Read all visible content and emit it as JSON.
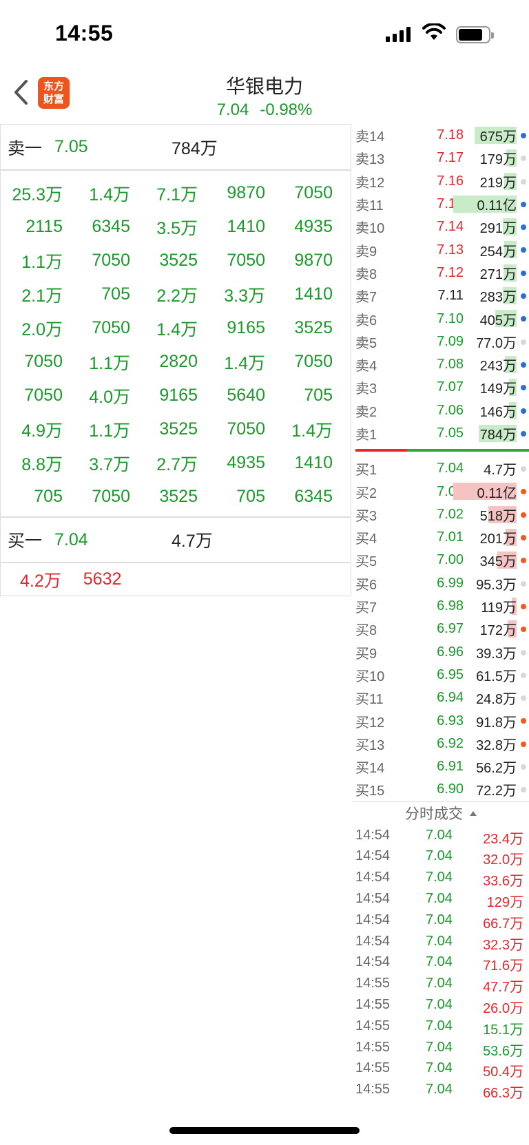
{
  "status_bar": {
    "time": "14:55"
  },
  "header": {
    "logo_text": "东方财富",
    "stock_name": "华银电力",
    "price": "7.04",
    "change_pct": "-0.98%"
  },
  "summary": {
    "sell_label": "卖一",
    "sell_price": "7.05",
    "sell_volume": "784万",
    "buy_label": "买一",
    "buy_price": "7.04",
    "buy_volume": "4.7万"
  },
  "queue_grid": [
    [
      "25.3万",
      "1.4万",
      "7.1万",
      "9870",
      "7050"
    ],
    [
      "2115",
      "6345",
      "3.5万",
      "1410",
      "4935"
    ],
    [
      "1.1万",
      "7050",
      "3525",
      "7050",
      "9870"
    ],
    [
      "2.1万",
      "705",
      "2.2万",
      "3.3万",
      "1410"
    ],
    [
      "2.0万",
      "7050",
      "1.4万",
      "9165",
      "3525"
    ],
    [
      "7050",
      "1.1万",
      "2820",
      "1.4万",
      "7050"
    ],
    [
      "7050",
      "4.0万",
      "9165",
      "5640",
      "705"
    ],
    [
      "4.9万",
      "1.1万",
      "3525",
      "7050",
      "1.4万"
    ],
    [
      "8.8万",
      "3.7万",
      "2.7万",
      "4935",
      "1410"
    ],
    [
      "705",
      "7050",
      "3525",
      "705",
      "6345"
    ]
  ],
  "buy_queue_extra": [
    "4.2万",
    "5632"
  ],
  "order_book": {
    "asks": [
      {
        "label": "卖14",
        "price": "7.18",
        "volume": "675万",
        "price_color": "red",
        "bar": 0.66,
        "dot": "blue"
      },
      {
        "label": "卖13",
        "price": "7.17",
        "volume": "179万",
        "price_color": "red",
        "bar": 0.16,
        "dot": "grey"
      },
      {
        "label": "卖12",
        "price": "7.16",
        "volume": "219万",
        "price_color": "red",
        "bar": 0.2,
        "dot": "grey"
      },
      {
        "label": "卖11",
        "price": "7.15",
        "volume": "0.11亿",
        "price_color": "red",
        "bar": 1.0,
        "dot": "blue"
      },
      {
        "label": "卖10",
        "price": "7.14",
        "volume": "291万",
        "price_color": "red",
        "bar": 0.22,
        "dot": "blue"
      },
      {
        "label": "卖9",
        "price": "7.13",
        "volume": "254万",
        "price_color": "red",
        "bar": 0.2,
        "dot": "blue"
      },
      {
        "label": "卖8",
        "price": "7.12",
        "volume": "271万",
        "price_color": "red",
        "bar": 0.21,
        "dot": "blue"
      },
      {
        "label": "卖7",
        "price": "7.11",
        "volume": "283万",
        "price_color": "black",
        "bar": 0.22,
        "dot": "blue"
      },
      {
        "label": "卖6",
        "price": "7.10",
        "volume": "405万",
        "price_color": "green",
        "bar": 0.34,
        "dot": "blue"
      },
      {
        "label": "卖5",
        "price": "7.09",
        "volume": "77.0万",
        "price_color": "green",
        "bar": 0.0,
        "dot": "grey"
      },
      {
        "label": "卖4",
        "price": "7.08",
        "volume": "243万",
        "price_color": "green",
        "bar": 0.18,
        "dot": "blue"
      },
      {
        "label": "卖3",
        "price": "7.07",
        "volume": "149万",
        "price_color": "green",
        "bar": 0.12,
        "dot": "blue"
      },
      {
        "label": "卖2",
        "price": "7.06",
        "volume": "146万",
        "price_color": "green",
        "bar": 0.12,
        "dot": "blue"
      },
      {
        "label": "卖1",
        "price": "7.05",
        "volume": "784万",
        "price_color": "green",
        "bar": 0.6,
        "dot": "blue"
      }
    ],
    "bids": [
      {
        "label": "买1",
        "price": "7.04",
        "volume": "4.7万",
        "price_color": "green",
        "bar": 0.0,
        "dot": "grey"
      },
      {
        "label": "买2",
        "price": "7.03",
        "volume": "0.11亿",
        "price_color": "green",
        "bar": 1.0,
        "dot": "orange"
      },
      {
        "label": "买3",
        "price": "7.02",
        "volume": "518万",
        "price_color": "green",
        "bar": 0.45,
        "dot": "orange"
      },
      {
        "label": "买4",
        "price": "7.01",
        "volume": "201万",
        "price_color": "green",
        "bar": 0.17,
        "dot": "orange"
      },
      {
        "label": "买5",
        "price": "7.00",
        "volume": "345万",
        "price_color": "green",
        "bar": 0.3,
        "dot": "orange"
      },
      {
        "label": "买6",
        "price": "6.99",
        "volume": "95.3万",
        "price_color": "green",
        "bar": 0.0,
        "dot": "grey"
      },
      {
        "label": "买7",
        "price": "6.98",
        "volume": "119万",
        "price_color": "green",
        "bar": 0.08,
        "dot": "orange"
      },
      {
        "label": "买8",
        "price": "6.97",
        "volume": "172万",
        "price_color": "green",
        "bar": 0.14,
        "dot": "orange"
      },
      {
        "label": "买9",
        "price": "6.96",
        "volume": "39.3万",
        "price_color": "green",
        "bar": 0.0,
        "dot": "grey"
      },
      {
        "label": "买10",
        "price": "6.95",
        "volume": "61.5万",
        "price_color": "green",
        "bar": 0.0,
        "dot": "grey"
      },
      {
        "label": "买11",
        "price": "6.94",
        "volume": "24.8万",
        "price_color": "green",
        "bar": 0.0,
        "dot": "grey"
      },
      {
        "label": "买12",
        "price": "6.93",
        "volume": "91.8万",
        "price_color": "green",
        "bar": 0.0,
        "dot": "orange"
      },
      {
        "label": "买13",
        "price": "6.92",
        "volume": "32.8万",
        "price_color": "green",
        "bar": 0.0,
        "dot": "orange"
      },
      {
        "label": "买14",
        "price": "6.91",
        "volume": "56.2万",
        "price_color": "green",
        "bar": 0.0,
        "dot": "grey"
      },
      {
        "label": "买15",
        "price": "6.90",
        "volume": "72.2万",
        "price_color": "green",
        "bar": 0.0,
        "dot": "grey"
      }
    ]
  },
  "ticks": {
    "title": "分时成交",
    "rows": [
      {
        "time": "14:54",
        "price": "7.04",
        "volume": "23.4万",
        "color": "red"
      },
      {
        "time": "14:54",
        "price": "7.04",
        "volume": "32.0万",
        "color": "red"
      },
      {
        "time": "14:54",
        "price": "7.04",
        "volume": "33.6万",
        "color": "red"
      },
      {
        "time": "14:54",
        "price": "7.04",
        "volume": "129万",
        "color": "red"
      },
      {
        "time": "14:54",
        "price": "7.04",
        "volume": "66.7万",
        "color": "red"
      },
      {
        "time": "14:54",
        "price": "7.04",
        "volume": "32.3万",
        "color": "red"
      },
      {
        "time": "14:54",
        "price": "7.04",
        "volume": "71.6万",
        "color": "red"
      },
      {
        "time": "14:55",
        "price": "7.04",
        "volume": "47.7万",
        "color": "red"
      },
      {
        "time": "14:55",
        "price": "7.04",
        "volume": "26.0万",
        "color": "red"
      },
      {
        "time": "14:55",
        "price": "7.04",
        "volume": "15.1万",
        "color": "green"
      },
      {
        "time": "14:55",
        "price": "7.04",
        "volume": "53.6万",
        "color": "green"
      },
      {
        "time": "14:55",
        "price": "7.04",
        "volume": "50.4万",
        "color": "red"
      },
      {
        "time": "14:55",
        "price": "7.04",
        "volume": "66.3万",
        "color": "red"
      }
    ]
  },
  "colors": {
    "green": "#1a9a2a",
    "red": "#e8262d",
    "bar_green": "#c7ecc7",
    "bar_red": "#f6c3c3",
    "logo": "#f0541e"
  }
}
